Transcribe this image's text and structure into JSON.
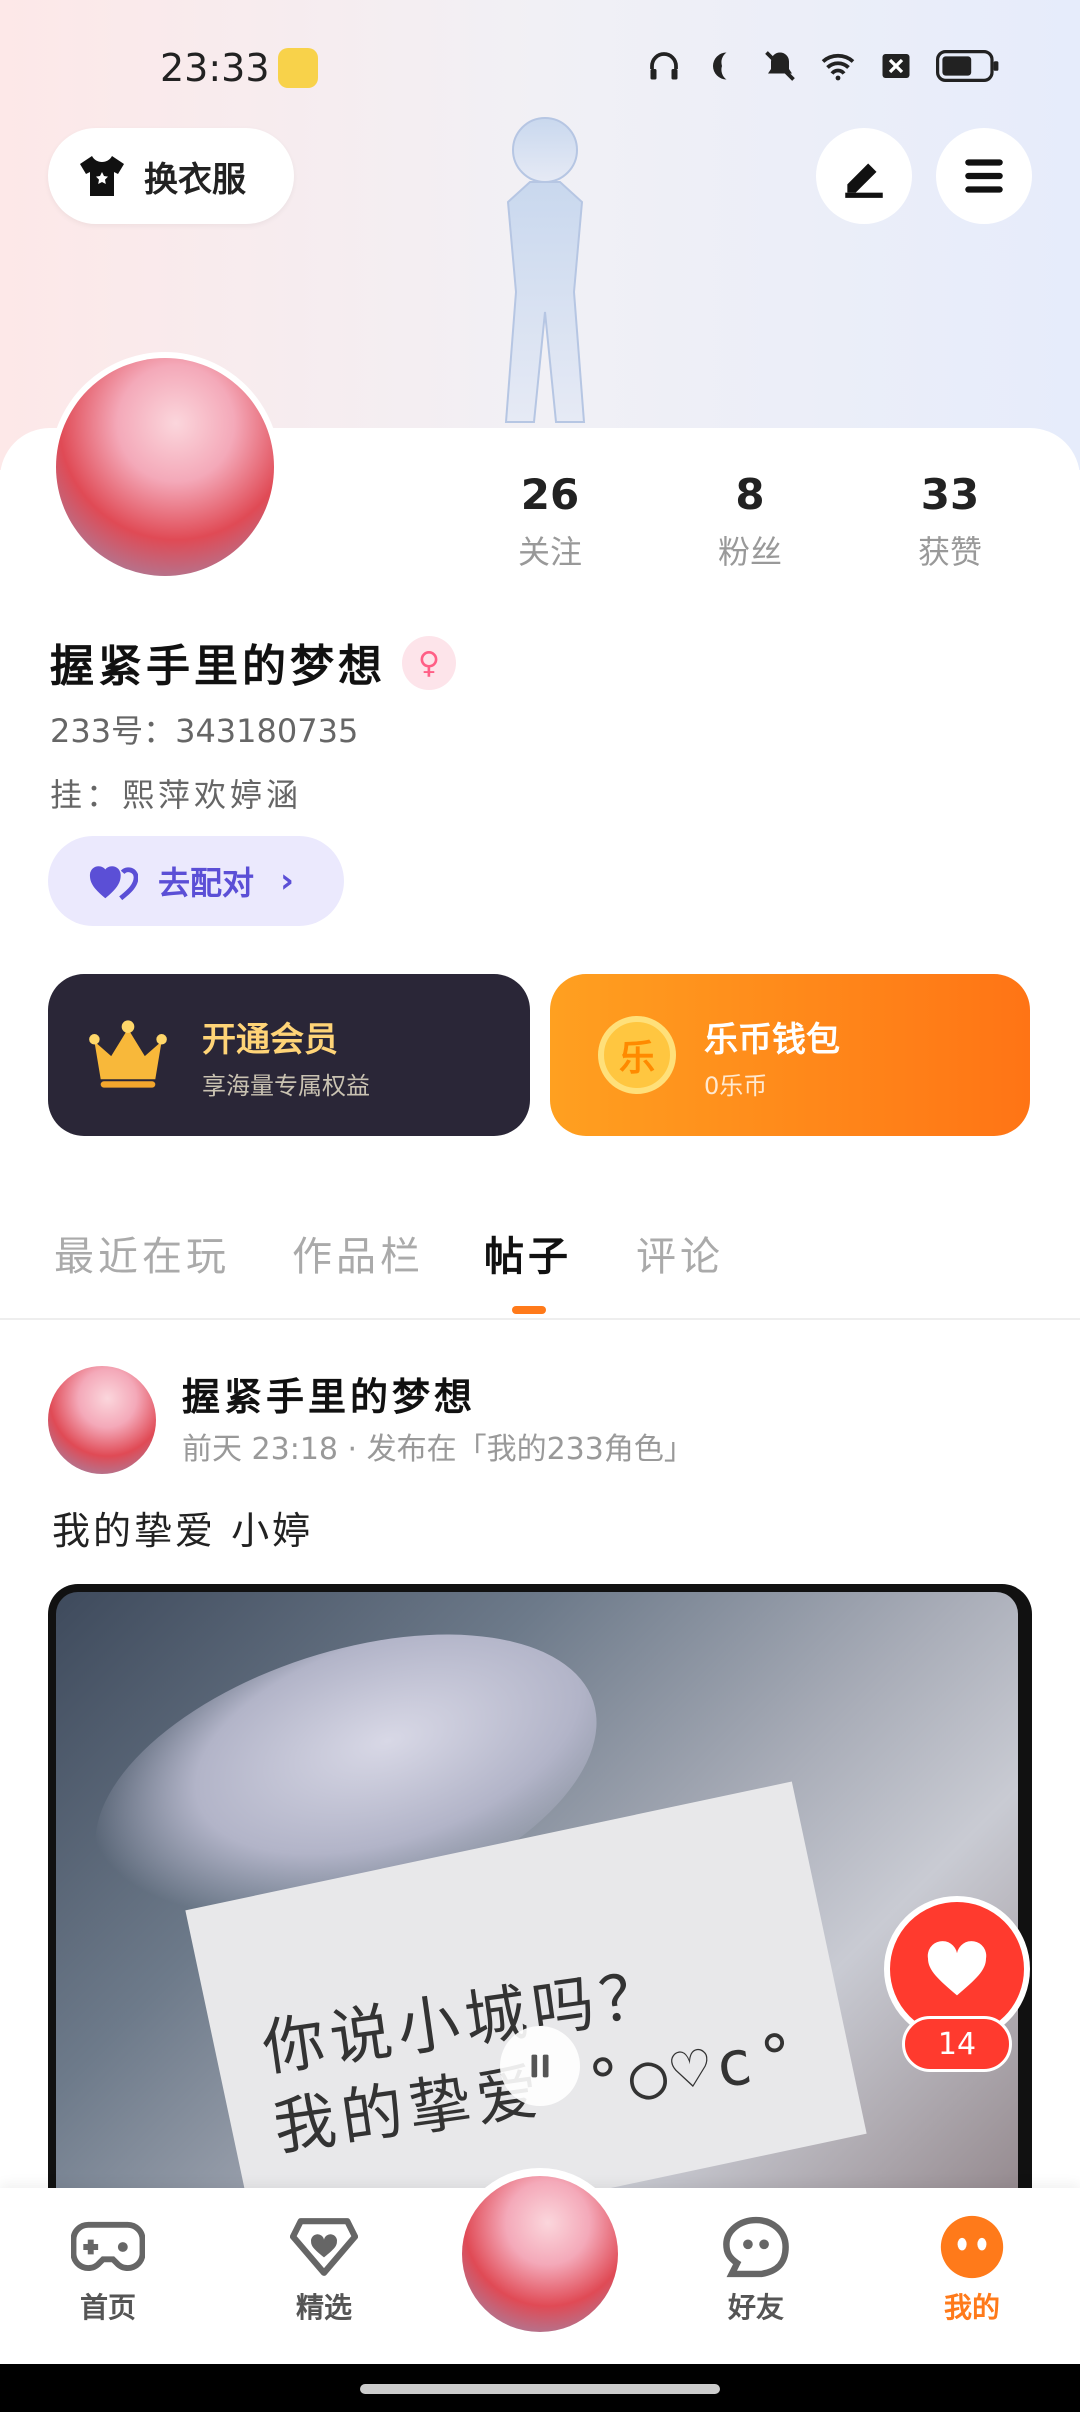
{
  "status_bar": {
    "time": "23:33"
  },
  "header": {
    "wardrobe_label": "换衣服"
  },
  "profile": {
    "stats": [
      {
        "value": "26",
        "label": "关注"
      },
      {
        "value": "8",
        "label": "粉丝"
      },
      {
        "value": "33",
        "label": "获赞"
      }
    ],
    "name": "握紧手里的梦想",
    "gender_symbol": "♀",
    "id_text": "233号：343180735",
    "signature": "挂：熙萍欢婷涵",
    "match_label": "去配对"
  },
  "cards": {
    "vip": {
      "title": "开通会员",
      "subtitle": "享海量专属权益"
    },
    "wallet": {
      "title": "乐币钱包",
      "subtitle": "0乐币",
      "coin_char": "乐"
    }
  },
  "tabs": [
    "最近在玩",
    "作品栏",
    "帖子",
    "评论"
  ],
  "active_tab": 2,
  "post": {
    "author": "握紧手里的梦想",
    "meta": "前天 23:18 · 发布在「我的233角色」",
    "text": "我的挚爱  小婷",
    "image_text_line1": "你说小城吗？",
    "image_text_line2": "我的挚爱 °○♡c°",
    "like_count": "14"
  },
  "nav": [
    {
      "label": "首页",
      "icon": "gamepad-icon"
    },
    {
      "label": "精选",
      "icon": "heart-box-icon"
    },
    {
      "label": "好友",
      "icon": "ghost-icon"
    },
    {
      "label": "我的",
      "icon": "smile-icon"
    }
  ],
  "colors": {
    "accent": "#ff7a1a",
    "like": "#ff3a2e",
    "vip_bg": "#2a2637",
    "match_bg": "#ebe9fd"
  }
}
